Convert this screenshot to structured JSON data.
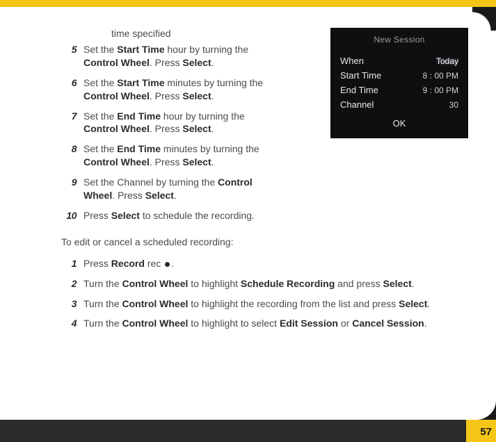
{
  "partial_line": "time specified",
  "steps_a": [
    {
      "num": "5",
      "html": "Set the <span class='b'>Start Time</span> hour by turning the <span class='b'>Control Wheel</span>. Press <span class='b'>Select</span>."
    },
    {
      "num": "6",
      "html": "Set the <span class='b'>Start Time</span> minutes by turning the <span class='b'>Control Wheel</span>. Press <span class='b'>Select</span>."
    },
    {
      "num": "7",
      "html": "Set the <span class='b'>End Time</span> hour by turning the <span class='b'>Control Wheel</span>. Press <span class='b'>Select</span>."
    },
    {
      "num": "8",
      "html": "Set the <span class='b'>End Time</span> minutes by turning the <span class='b'>Control Wheel</span>. Press <span class='b'>Select</span>."
    },
    {
      "num": "9",
      "html": "Set the Channel by turning the <span class='b'>Control Wheel</span>. Press <span class='b'>Select</span>."
    },
    {
      "num": "10",
      "html": "Press <span class='b'>Select</span> to schedule the recording."
    }
  ],
  "subheading": "To edit or cancel a scheduled recording:",
  "steps_b": [
    {
      "num": "1",
      "html": "Press <span class='b'>Record</span> <span class='rec-label'>rec</span> <span class='rec-dot' data-name='record-icon' data-interactable='false'></span>."
    },
    {
      "num": "2",
      "html": "Turn the <span class='b'>Control Wheel</span> to highlight <span class='b'>Schedule Recording</span> and press <span class='b'>Select</span>."
    },
    {
      "num": "3",
      "html": "Turn the <span class='b'>Control Wheel</span> to highlight the recording from the list and press <span class='b'>Select</span>."
    },
    {
      "num": "4",
      "html": "Turn the <span class='b'>Control Wheel</span> to highlight to select <span class='b'>Edit Session</span> or <span class='b'>Cancel Session</span>."
    }
  ],
  "screen": {
    "title": "New Session",
    "rows": [
      {
        "label": "When",
        "value": "Today",
        "highlight": true
      },
      {
        "label": "Start Time",
        "value": "8 : 00  PM",
        "highlight": false
      },
      {
        "label": "End Time",
        "value": "9 : 00  PM",
        "highlight": false
      },
      {
        "label": "Channel",
        "value": "30",
        "highlight": false
      }
    ],
    "ok": "OK"
  },
  "page_number": "57"
}
